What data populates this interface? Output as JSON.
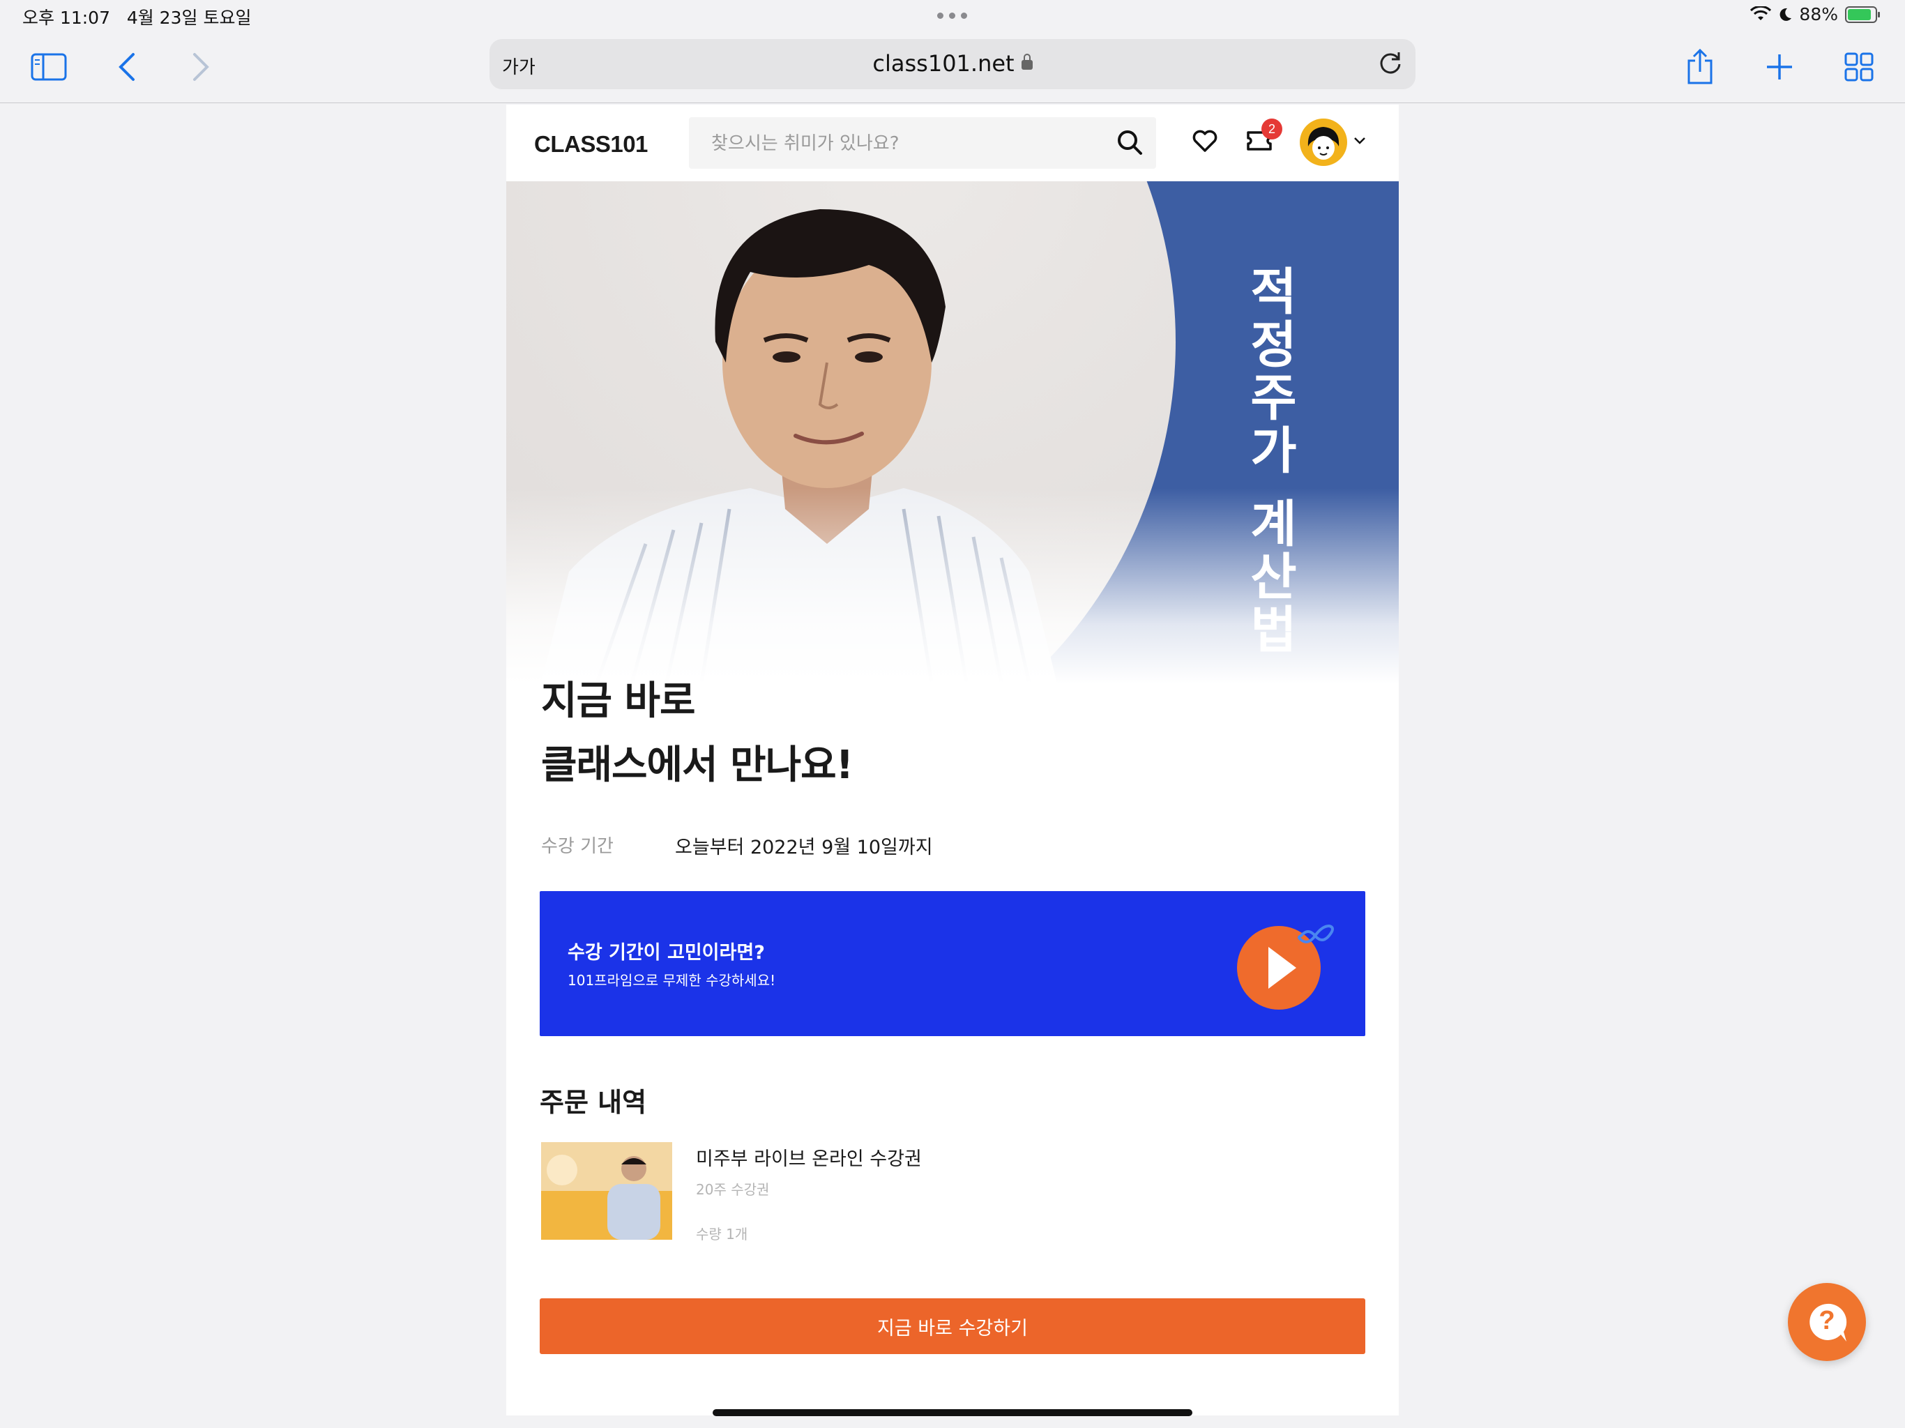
{
  "status_bar": {
    "time_date": "오후 11:07   4월 23일 토요일",
    "battery": "88%",
    "battery_level": 0.88
  },
  "browser": {
    "text_size_label": "가가",
    "url": "class101.net",
    "icons": [
      "sidebar-icon",
      "back-icon",
      "forward-icon",
      "reload-icon",
      "share-icon",
      "plus-icon",
      "tabs-icon"
    ]
  },
  "site": {
    "logo": "CLASS101",
    "search_placeholder": "찾으시는 취미가 있나요?",
    "cart_count": "2"
  },
  "hero": {
    "vertical_title": "적정주가 계산법"
  },
  "main": {
    "headline_line1": "지금 바로",
    "headline_line2": "클래스에서 만나요!",
    "period_label": "수강 기간",
    "period_value": "오늘부터 2022년 9월 10일까지"
  },
  "banner": {
    "title": "수강 기간이 고민이라면?",
    "subtitle": "101프라임으로 무제한 수강하세요!"
  },
  "orders": {
    "title": "주문 내역",
    "items": [
      {
        "name": "미주부 라이브 온라인 수강권",
        "subtitle": "20주 수강권",
        "quantity": "수량 1개"
      }
    ]
  },
  "cta": {
    "label": "지금 바로 수강하기"
  },
  "help": {
    "label": "?"
  },
  "colors": {
    "brand_orange": "#ec652a",
    "banner_blue": "#1b33e8",
    "hero_blue": "#3d5ea3",
    "badge_red": "#e53935",
    "ios_blue": "#1a73e8"
  }
}
